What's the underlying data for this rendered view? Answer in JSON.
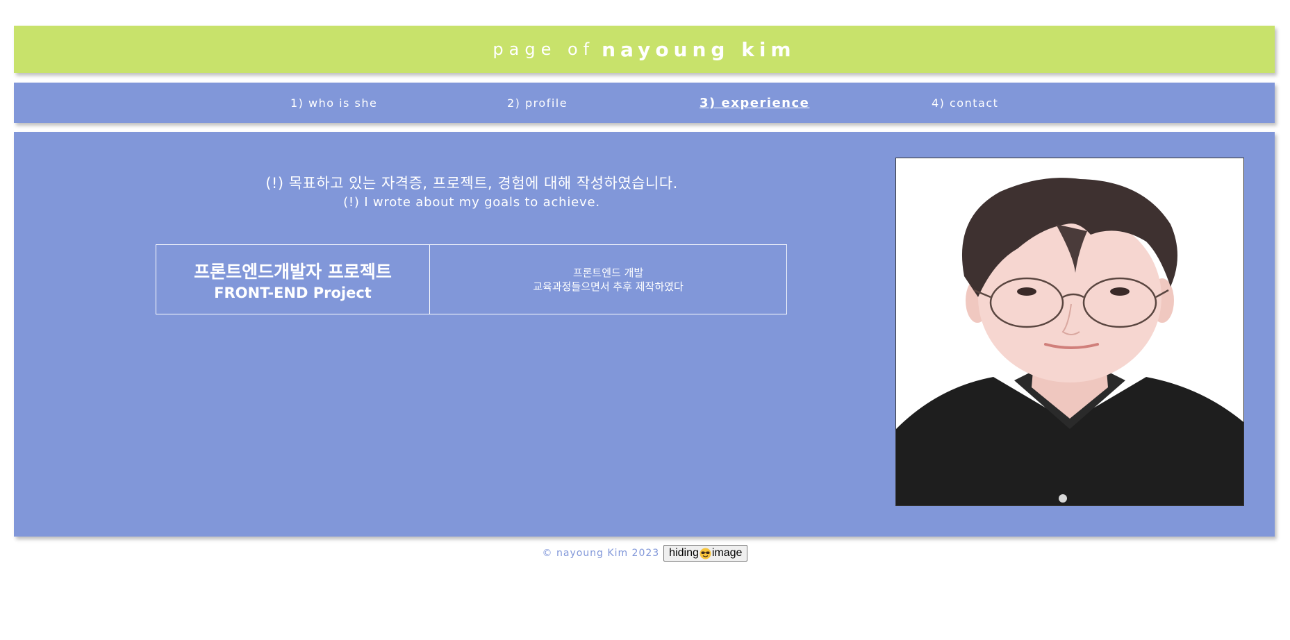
{
  "header": {
    "prefix": "page of",
    "name": "nayoung kim"
  },
  "nav": {
    "items": [
      {
        "label": "1) who is she",
        "active": false
      },
      {
        "label": "2) profile",
        "active": false
      },
      {
        "label": "3) experience ",
        "active": true
      },
      {
        "label": "4) contact",
        "active": false
      }
    ]
  },
  "main": {
    "intro_ko": "(!) 목표하고 있는 자격증, 프로젝트, 경험에 대해 작성하였습니다.",
    "intro_en": "(!) I wrote about my goals to achieve.",
    "project": {
      "title_ko": "프론트엔드개발자 프로젝트",
      "title_en": "FRONT-END Project",
      "desc_line1": "프론트엔드 개발",
      "desc_line2": "교육과정들으면서 추후 제작하였다"
    }
  },
  "footer": {
    "copyright": "© nayoung Kim 2023",
    "button_text_before": "hiding",
    "button_emoji": "smiling-face-with-sunglasses-icon",
    "button_text_after": "image"
  },
  "colors": {
    "header_bg": "#c8e26b",
    "nav_bg": "#8197d9",
    "main_bg": "#8197d9",
    "text": "#ffffff"
  }
}
